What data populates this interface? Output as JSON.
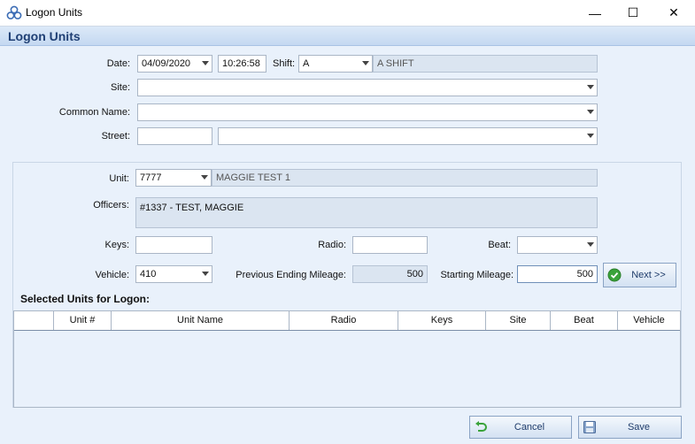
{
  "window": {
    "title": "Logon Units",
    "header_title": "Logon Units",
    "controls": {
      "minimize": "—",
      "maximize": "☐",
      "close": "✕"
    }
  },
  "form": {
    "date_label": "Date:",
    "date_value": "04/09/2020",
    "time_value": "10:26:58",
    "shift_label": "Shift:",
    "shift_value": "A",
    "shift_desc": "A SHIFT",
    "site_label": "Site:",
    "site_value": "",
    "common_name_label": "Common Name:",
    "common_name_value": "",
    "street_label": "Street:",
    "street_number_value": "",
    "street_name_value": ""
  },
  "unit_panel": {
    "unit_label": "Unit:",
    "unit_value": "7777",
    "unit_name": "MAGGIE TEST 1",
    "officers_label": "Officers:",
    "officers_value": "#1337 - TEST, MAGGIE",
    "keys_label": "Keys:",
    "keys_value": "",
    "radio_label": "Radio:",
    "radio_value": "",
    "beat_label": "Beat:",
    "beat_value": "",
    "vehicle_label": "Vehicle:",
    "vehicle_value": "410",
    "prev_mileage_label": "Previous Ending Mileage:",
    "prev_mileage_value": "500",
    "start_mileage_label": "Starting Mileage:",
    "start_mileage_value": "500",
    "next_label": "Next >>"
  },
  "selected": {
    "title": "Selected Units for Logon:",
    "columns": [
      "Unit #",
      "Unit Name",
      "Radio",
      "Keys",
      "Site",
      "Beat",
      "Vehicle"
    ]
  },
  "footer": {
    "cancel_label": "Cancel",
    "save_label": "Save"
  },
  "colors": {
    "header_text": "#1f3f74",
    "background": "#e9f1fb",
    "readonly_field": "#dbe5f1",
    "next_icon": "#3aa33a"
  },
  "icons": {
    "app": "app-logo-icon",
    "next": "check-circle-icon",
    "cancel": "undo-arrow-icon",
    "save": "floppy-disk-icon"
  }
}
